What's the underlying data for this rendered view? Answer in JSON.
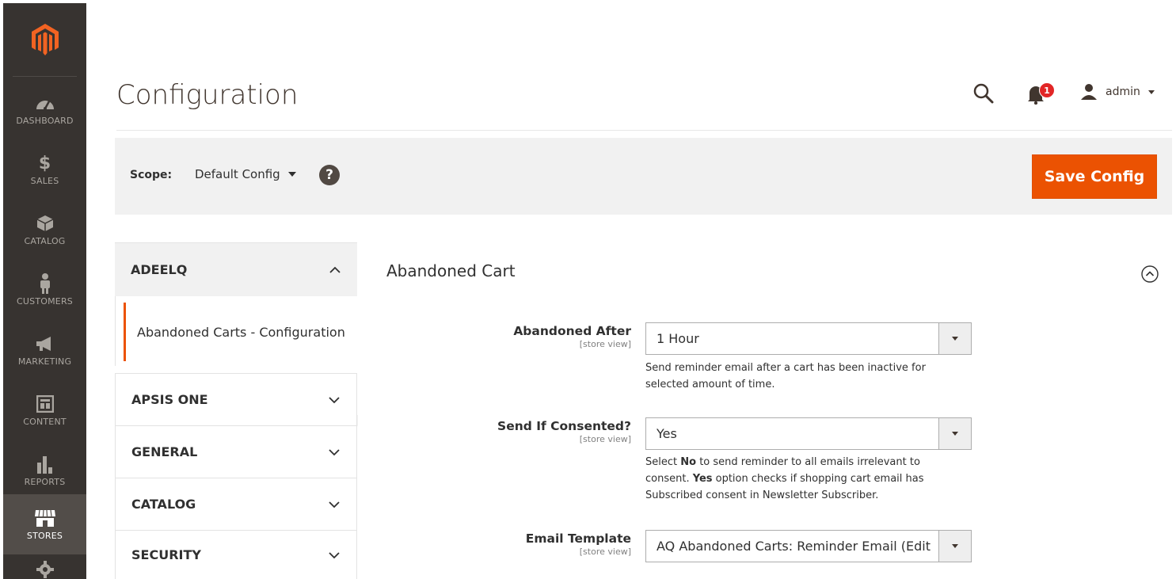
{
  "sidebar": {
    "items": [
      {
        "label": "DASHBOARD",
        "icon": "dashboard-icon"
      },
      {
        "label": "SALES",
        "icon": "dollar-icon"
      },
      {
        "label": "CATALOG",
        "icon": "box-icon"
      },
      {
        "label": "CUSTOMERS",
        "icon": "person-icon"
      },
      {
        "label": "MARKETING",
        "icon": "megaphone-icon"
      },
      {
        "label": "CONTENT",
        "icon": "layout-icon"
      },
      {
        "label": "REPORTS",
        "icon": "bar-chart-icon"
      },
      {
        "label": "STORES",
        "icon": "store-icon",
        "active": true
      }
    ]
  },
  "header": {
    "title": "Configuration",
    "notifications_count": "1",
    "user_name": "admin"
  },
  "scope": {
    "label": "Scope:",
    "value": "Default Config",
    "help": "?"
  },
  "toolbar": {
    "save_label": "Save Config"
  },
  "tabs": {
    "open": {
      "label": "ADEELQ",
      "items": [
        "Abandoned Carts - Configuration"
      ]
    },
    "closed": [
      "APSIS ONE",
      "GENERAL",
      "CATALOG",
      "SECURITY"
    ]
  },
  "section": {
    "title": "Abandoned Cart",
    "fields": [
      {
        "label": "Abandoned After",
        "scope": "[store view]",
        "value": "1 Hour",
        "note": "Send reminder email after a cart has been inactive for selected amount of time."
      },
      {
        "label": "Send If Consented?",
        "scope": "[store view]",
        "value": "Yes",
        "note_parts": [
          "Select ",
          "No",
          " to send reminder to all emails irrelevant to consent. ",
          "Yes",
          " option checks if shopping cart email has Subscribed consent in Newsletter Subscriber."
        ]
      },
      {
        "label": "Email Template",
        "scope": "[store view]",
        "value": "AQ Abandoned Carts: Reminder Email (Edit"
      }
    ]
  },
  "colors": {
    "sidebar_bg": "#373330",
    "accent": "#eb5202",
    "badge": "#e22626"
  }
}
